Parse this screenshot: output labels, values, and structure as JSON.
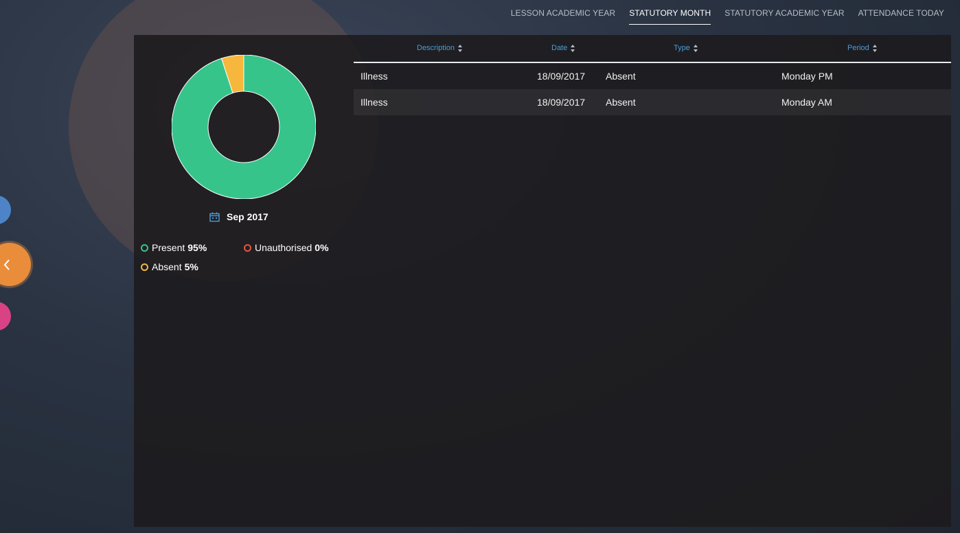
{
  "tabs": [
    {
      "label": "LESSON ACADEMIC YEAR",
      "active": false
    },
    {
      "label": "STATUTORY MONTH",
      "active": true
    },
    {
      "label": "STATUTORY ACADEMIC YEAR",
      "active": false
    },
    {
      "label": "ATTENDANCE TODAY",
      "active": false
    }
  ],
  "summary": {
    "month": "Sep 2017",
    "legend": [
      {
        "label": "Present",
        "value": "95%",
        "color": "#36c48b"
      },
      {
        "label": "Unauthorised",
        "value": "0%",
        "color": "#e8553e"
      },
      {
        "label": "Absent",
        "value": "5%",
        "color": "#f6b73c"
      }
    ]
  },
  "chart_data": {
    "type": "pie",
    "categories": [
      "Present",
      "Unauthorised",
      "Absent"
    ],
    "values": [
      95,
      0,
      5
    ],
    "colors": [
      "#36c48b",
      "#e8553e",
      "#f6b73c"
    ],
    "donut": true
  },
  "table": {
    "headers": [
      "Description",
      "Date",
      "Type",
      "Period"
    ],
    "rows": [
      {
        "description": "Illness",
        "date": "18/09/2017",
        "type": "Absent",
        "period": "Monday PM"
      },
      {
        "description": "Illness",
        "date": "18/09/2017",
        "type": "Absent",
        "period": "Monday AM"
      }
    ]
  },
  "icons": {
    "back": "chevron-left-icon",
    "calendar": "calendar-icon",
    "sort": "sort-icon"
  }
}
